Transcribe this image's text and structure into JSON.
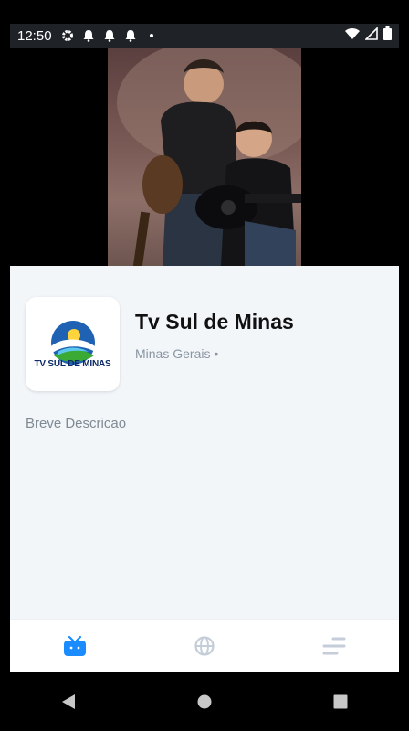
{
  "status_bar": {
    "time": "12:50",
    "icons": [
      "gear-icon",
      "bell-icon",
      "bell-icon",
      "bell-icon",
      "dot-icon"
    ],
    "right_icons": [
      "wifi-icon",
      "signal-icon",
      "battery-icon"
    ]
  },
  "channel": {
    "name": "Tv Sul de Minas",
    "location": "Minas Gerais •",
    "logo_text": "TV SUL DE MINAS",
    "description": "Breve Descricao"
  },
  "bottom_nav": {
    "items": [
      {
        "name": "tv-icon",
        "active": true
      },
      {
        "name": "globe-icon",
        "active": false
      },
      {
        "name": "menu-lines-icon",
        "active": false
      }
    ]
  },
  "colors": {
    "accent": "#1a8cff",
    "inactive": "#c5ced8",
    "background": "#f2f6f9"
  }
}
